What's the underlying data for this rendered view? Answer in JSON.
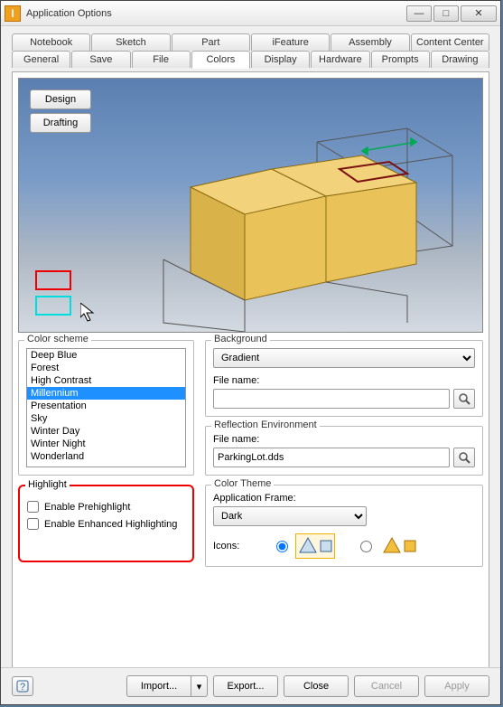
{
  "window": {
    "title": "Application Options"
  },
  "tabs_row1": [
    {
      "label": "Notebook"
    },
    {
      "label": "Sketch"
    },
    {
      "label": "Part"
    },
    {
      "label": "iFeature"
    },
    {
      "label": "Assembly"
    },
    {
      "label": "Content Center"
    }
  ],
  "tabs_row2": [
    {
      "label": "General"
    },
    {
      "label": "Save"
    },
    {
      "label": "File"
    },
    {
      "label": "Colors",
      "active": true
    },
    {
      "label": "Display"
    },
    {
      "label": "Hardware"
    },
    {
      "label": "Prompts"
    },
    {
      "label": "Drawing"
    }
  ],
  "preview_buttons": {
    "design": "Design",
    "drafting": "Drafting"
  },
  "color_scheme": {
    "legend": "Color scheme",
    "items": [
      "Deep Blue",
      "Forest",
      "High Contrast",
      "Millennium",
      "Presentation",
      "Sky",
      "Winter Day",
      "Winter Night",
      "Wonderland"
    ],
    "selected": "Millennium"
  },
  "highlight": {
    "legend": "Highlight",
    "prehighlight": "Enable Prehighlight",
    "enhanced": "Enable Enhanced Highlighting"
  },
  "background": {
    "legend": "Background",
    "select_value": "Gradient",
    "filename_label": "File name:",
    "filename_value": ""
  },
  "reflection": {
    "legend": "Reflection Environment",
    "filename_label": "File name:",
    "filename_value": "ParkingLot.dds"
  },
  "color_theme": {
    "legend": "Color Theme",
    "frame_label": "Application Frame:",
    "frame_value": "Dark",
    "icons_label": "Icons:"
  },
  "buttons": {
    "import": "Import...",
    "export": "Export...",
    "close": "Close",
    "cancel": "Cancel",
    "apply": "Apply"
  },
  "icons": {
    "browse": "browse-icon",
    "help": "?",
    "dropdown": "▾"
  }
}
